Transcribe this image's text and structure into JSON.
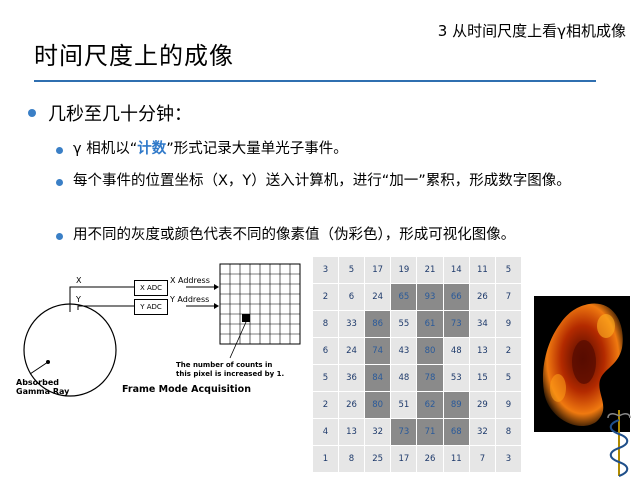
{
  "header": {
    "chapter": "3 从时间尺度上看γ相机成像",
    "title": "时间尺度上的成像"
  },
  "bullets": {
    "l1": "几秒至几十分钟：",
    "l2_1_pre": "γ 相机以“",
    "l2_1_hl": "计数",
    "l2_1_post": "”形式记录大量单光子事件。",
    "l2_2": "每个事件的位置坐标（X，Y）送入计算机，进行“加一”累积，形成数字图像。",
    "l2_3": "用不同的灰度或颜色代表不同的像素值（伪彩色），形成可视化图像。"
  },
  "diagram": {
    "x": "X",
    "y": "Y",
    "x_adc": "X ADC",
    "y_adc": "Y ADC",
    "x_address": "X Address",
    "y_address": "Y Address",
    "note": "The number of counts in this pixel is increased by 1.",
    "absorbed": "Absorbed Gamma Ray",
    "caption": "Frame Mode Acquisition"
  },
  "matrix": [
    [
      "3",
      "5",
      "17",
      "19",
      "21",
      "14",
      "11",
      "5"
    ],
    [
      "2",
      "6",
      "24",
      "65",
      "93",
      "66",
      "26",
      "7"
    ],
    [
      "8",
      "33",
      "86",
      "55",
      "61",
      "73",
      "34",
      "9"
    ],
    [
      "6",
      "24",
      "74",
      "43",
      "80",
      "48",
      "13",
      "2"
    ],
    [
      "5",
      "36",
      "84",
      "48",
      "78",
      "53",
      "15",
      "5"
    ],
    [
      "2",
      "26",
      "80",
      "51",
      "62",
      "89",
      "29",
      "9"
    ],
    [
      "4",
      "13",
      "32",
      "73",
      "71",
      "68",
      "32",
      "8"
    ],
    [
      "1",
      "8",
      "25",
      "17",
      "26",
      "11",
      "7",
      "3"
    ]
  ],
  "colors": {
    "accent": "#2f6fb0",
    "bullet": "#3a7fc6",
    "highlight": "#2f79c9"
  }
}
